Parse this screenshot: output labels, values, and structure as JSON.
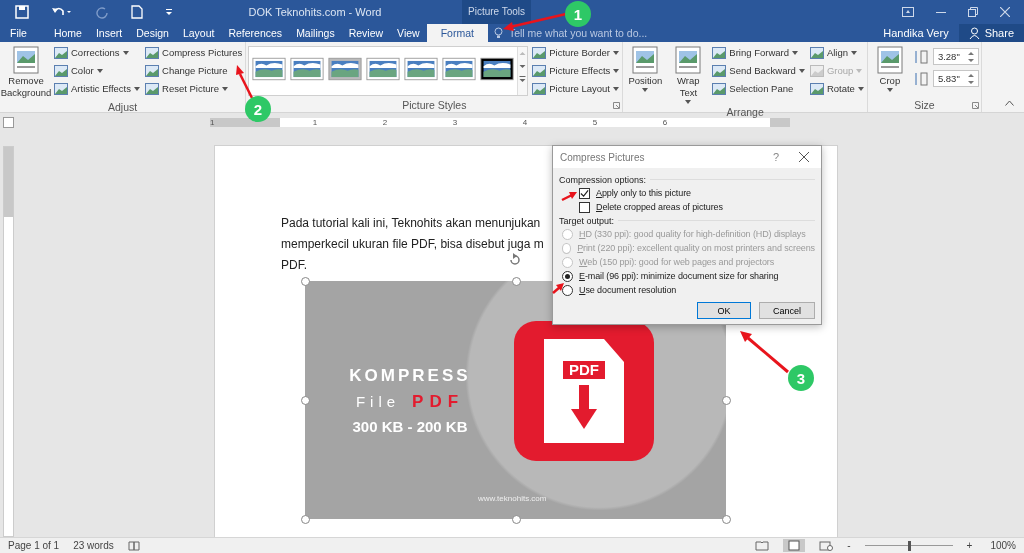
{
  "title_bar": {
    "title": "DOK Teknohits.com - Word",
    "contextual_tab": "Picture Tools"
  },
  "tabs": [
    {
      "label": "File",
      "selected": false
    },
    {
      "label": "Home",
      "selected": false
    },
    {
      "label": "Insert",
      "selected": false
    },
    {
      "label": "Design",
      "selected": false
    },
    {
      "label": "Layout",
      "selected": false
    },
    {
      "label": "References",
      "selected": false
    },
    {
      "label": "Mailings",
      "selected": false
    },
    {
      "label": "Review",
      "selected": false
    },
    {
      "label": "View",
      "selected": false
    },
    {
      "label": "Format",
      "selected": true
    }
  ],
  "tell_me": {
    "placeholder": "Tell me what you want to do..."
  },
  "user": "Handika Very",
  "share": "Share",
  "ribbon": [
    {
      "label": "Adjust",
      "launcher": false,
      "columns": [
        {
          "kind": "large",
          "items": [
            {
              "label": "Remove Background",
              "dropdown": false,
              "disabled": false
            }
          ]
        },
        {
          "kind": "stack",
          "items": [
            {
              "label": "Corrections",
              "dropdown": true,
              "disabled": false
            },
            {
              "label": "Color",
              "dropdown": true,
              "disabled": false
            },
            {
              "label": "Artistic Effects",
              "dropdown": true,
              "disabled": false
            }
          ]
        },
        {
          "kind": "stack",
          "items": [
            {
              "label": "Compress Pictures",
              "dropdown": false,
              "disabled": false
            },
            {
              "label": "Change Picture",
              "dropdown": false,
              "disabled": false
            },
            {
              "label": "Reset Picture",
              "dropdown": true,
              "disabled": false
            }
          ]
        }
      ]
    },
    {
      "label": "Picture Styles",
      "launcher": true,
      "columns": [
        {
          "kind": "gallery"
        },
        {
          "kind": "stack",
          "items": [
            {
              "label": "Picture Border",
              "dropdown": true,
              "disabled": false
            },
            {
              "label": "Picture Effects",
              "dropdown": true,
              "disabled": false
            },
            {
              "label": "Picture Layout",
              "dropdown": true,
              "disabled": false
            }
          ]
        }
      ]
    },
    {
      "label": "Arrange",
      "launcher": false,
      "columns": [
        {
          "kind": "large",
          "items": [
            {
              "label": "Position",
              "dropdown": true,
              "disabled": false
            }
          ]
        },
        {
          "kind": "large",
          "items": [
            {
              "label": "Wrap Text",
              "dropdown": true,
              "disabled": false
            }
          ]
        },
        {
          "kind": "stack",
          "items": [
            {
              "label": "Bring Forward",
              "dropdown": true,
              "disabled": false
            },
            {
              "label": "Send Backward",
              "dropdown": true,
              "disabled": false
            },
            {
              "label": "Selection Pane",
              "dropdown": false,
              "disabled": false
            }
          ]
        },
        {
          "kind": "stack",
          "items": [
            {
              "label": "Align",
              "dropdown": true,
              "disabled": false
            },
            {
              "label": "Group",
              "dropdown": true,
              "disabled": true
            },
            {
              "label": "Rotate",
              "dropdown": true,
              "disabled": false
            }
          ]
        }
      ]
    },
    {
      "label": "Size",
      "launcher": true,
      "columns": [
        {
          "kind": "large",
          "items": [
            {
              "label": "Crop",
              "dropdown": true,
              "disabled": false
            }
          ]
        },
        {
          "kind": "spin",
          "items": [
            {
              "value": "3.28\""
            },
            {
              "value": "5.83\""
            }
          ]
        }
      ]
    }
  ],
  "ruler": [
    "1",
    "1",
    "2",
    "3",
    "4",
    "5",
    "6"
  ],
  "document": {
    "lines": [
      "Pada tutorial kali ini, Teknohits akan menunjukan",
      "memperkecil ukuran file PDF, bisa disebut juga m",
      "PDF."
    ],
    "picture": {
      "title": "KOMPRESS",
      "subtitle": "File",
      "highlight": "PDF",
      "sizes": "300 KB - 200 KB",
      "badge": "PDF",
      "url": "www.teknohits.com"
    }
  },
  "dialog": {
    "title": "Compress Pictures",
    "help": "?",
    "compression": {
      "heading": "Compression options:",
      "checkboxes": [
        {
          "label": "Apply only to this picture",
          "checked": true
        },
        {
          "label": "Delete cropped areas of pictures",
          "checked": false
        }
      ]
    },
    "target": {
      "heading": "Target output:",
      "options": [
        {
          "label": "HD (330 ppi): good quality for high-definition (HD) displays",
          "selected": false,
          "disabled": true
        },
        {
          "label": "Print (220 ppi): excellent quality on most printers and screens",
          "selected": false,
          "disabled": true
        },
        {
          "label": "Web (150 ppi): good for web pages and projectors",
          "selected": false,
          "disabled": true
        },
        {
          "label": "E-mail (96 ppi): minimize document size for sharing",
          "selected": true,
          "disabled": false
        },
        {
          "label": "Use document resolution",
          "selected": false,
          "disabled": false
        }
      ]
    },
    "buttons": [
      "OK",
      "Cancel"
    ]
  },
  "status_bar": {
    "page": "Page 1 of 1",
    "words": "23 words",
    "zoom_out": "-",
    "zoom_in": "+",
    "zoom": "100%",
    "zoom_slider": {
      "level": 0.5
    }
  },
  "annotations": [
    {
      "number": "1"
    },
    {
      "number": "2"
    },
    {
      "number": "3"
    }
  ]
}
